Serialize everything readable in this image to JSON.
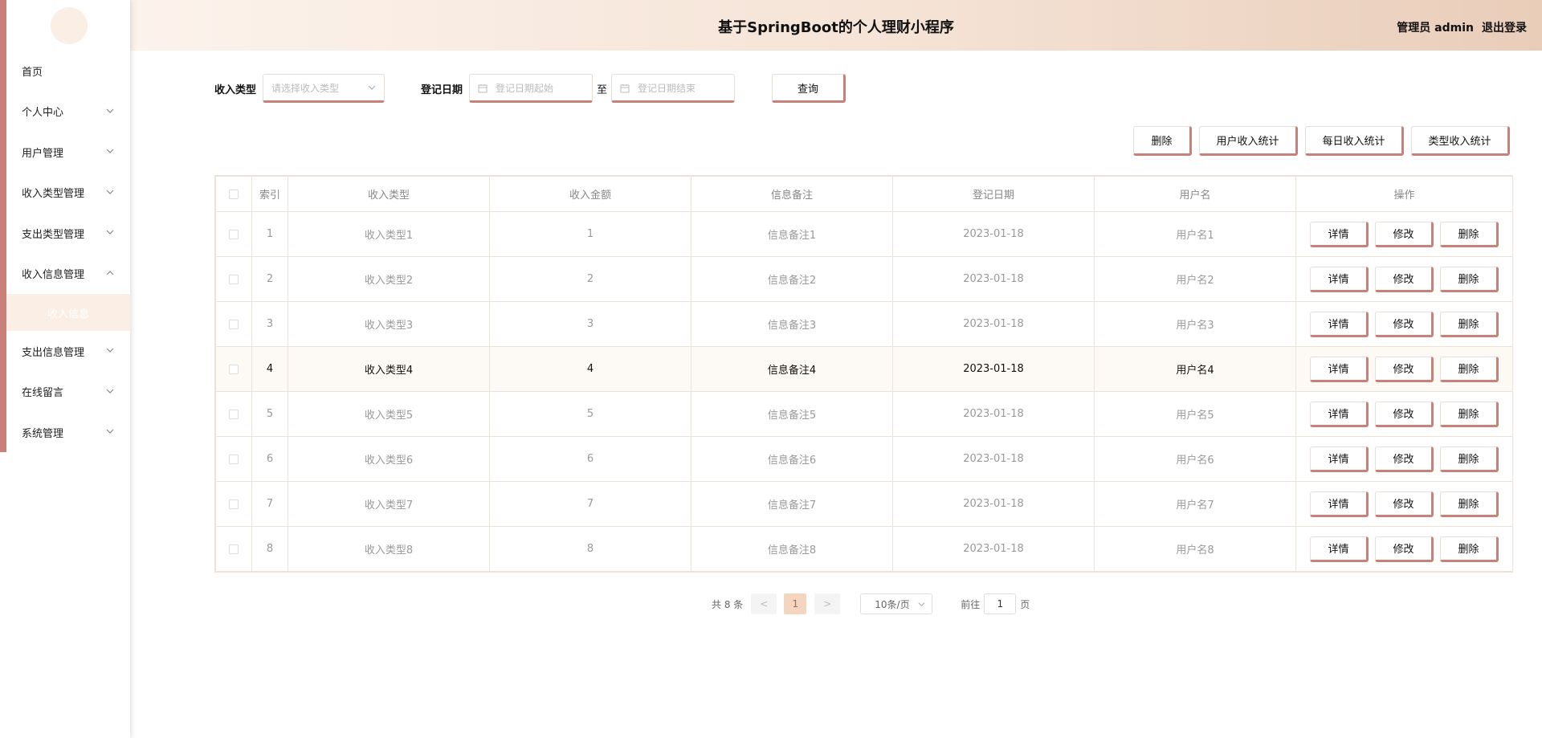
{
  "header": {
    "title": "基于SpringBoot的个人理财小程序",
    "user": "管理员 admin",
    "logout": "退出登录"
  },
  "sidebar": {
    "items": [
      {
        "label": "首页"
      },
      {
        "label": "个人中心"
      },
      {
        "label": "用户管理"
      },
      {
        "label": "收入类型管理"
      },
      {
        "label": "支出类型管理"
      },
      {
        "label": "收入信息管理"
      },
      {
        "label": "支出信息管理"
      },
      {
        "label": "在线留言"
      },
      {
        "label": "系统管理"
      }
    ],
    "submenu": {
      "label": "收入信息"
    }
  },
  "search": {
    "type_label": "收入类型",
    "type_placeholder": "请选择收入类型",
    "date_label": "登记日期",
    "date_start_placeholder": "登记日期起始",
    "to": "至",
    "date_end_placeholder": "登记日期结束",
    "query": "查询"
  },
  "actions": {
    "delete": "删除",
    "user_stats": "用户收入统计",
    "daily_stats": "每日收入统计",
    "type_stats": "类型收入统计"
  },
  "table": {
    "headers": [
      "索引",
      "收入类型",
      "收入金额",
      "信息备注",
      "登记日期",
      "用户名",
      "操作"
    ],
    "op_labels": {
      "detail": "详情",
      "edit": "修改",
      "delete": "删除"
    },
    "rows": [
      {
        "index": "1",
        "type": "收入类型1",
        "amount": "1",
        "note": "信息备注1",
        "date": "2023-01-18",
        "user": "用户名1"
      },
      {
        "index": "2",
        "type": "收入类型2",
        "amount": "2",
        "note": "信息备注2",
        "date": "2023-01-18",
        "user": "用户名2"
      },
      {
        "index": "3",
        "type": "收入类型3",
        "amount": "3",
        "note": "信息备注3",
        "date": "2023-01-18",
        "user": "用户名3"
      },
      {
        "index": "4",
        "type": "收入类型4",
        "amount": "4",
        "note": "信息备注4",
        "date": "2023-01-18",
        "user": "用户名4"
      },
      {
        "index": "5",
        "type": "收入类型5",
        "amount": "5",
        "note": "信息备注5",
        "date": "2023-01-18",
        "user": "用户名5"
      },
      {
        "index": "6",
        "type": "收入类型6",
        "amount": "6",
        "note": "信息备注6",
        "date": "2023-01-18",
        "user": "用户名6"
      },
      {
        "index": "7",
        "type": "收入类型7",
        "amount": "7",
        "note": "信息备注7",
        "date": "2023-01-18",
        "user": "用户名7"
      },
      {
        "index": "8",
        "type": "收入类型8",
        "amount": "8",
        "note": "信息备注8",
        "date": "2023-01-18",
        "user": "用户名8"
      }
    ]
  },
  "pagination": {
    "total": "共 8 条",
    "prev": "<",
    "current": "1",
    "next": ">",
    "page_size": "10条/页",
    "goto_prefix": "前往",
    "goto_value": "1",
    "goto_suffix": "页"
  },
  "colors": {
    "accent": "#c98078",
    "header_gradient_start": "#fcf3ec",
    "header_gradient_end": "#e9cdb9",
    "submenu_bg": "#fbeee4",
    "active_page": "#f3d5c0"
  }
}
